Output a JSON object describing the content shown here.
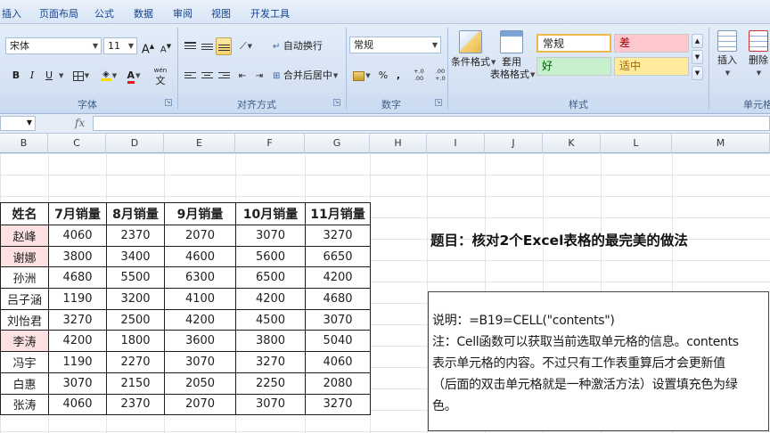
{
  "menu": {
    "items": [
      "插入",
      "页面布局",
      "公式",
      "数据",
      "审阅",
      "视图",
      "开发工具"
    ]
  },
  "ribbon": {
    "font_group": {
      "label": "字体",
      "font_name": "宋体",
      "font_size": "11",
      "grow_label": "A",
      "shrink_label": "A",
      "bold": "B",
      "italic": "I",
      "underline": "U",
      "font_color_label": "A",
      "phonetic_label": "wén",
      "phonetic_char": "文"
    },
    "align_group": {
      "label": "对齐方式",
      "wrap_label": "自动换行",
      "merge_label": "合并后居中"
    },
    "number_group": {
      "label": "数字",
      "format": "常规",
      "percent": "%",
      "comma": ",",
      "inc_decimal": "+.0 .00",
      "dec_decimal": ".00 +.0"
    },
    "styles_group": {
      "label": "样式",
      "conditional_label": "条件格式",
      "table_label_1": "套用",
      "table_label_2": "表格格式",
      "styles": {
        "normal": "常规",
        "bad": "差",
        "good": "好",
        "neutral": "适中"
      }
    },
    "cells_group": {
      "label": "单元格",
      "insert_label": "插入",
      "delete_label": "删除"
    }
  },
  "formula_bar": {
    "fx_label": "fx",
    "value": ""
  },
  "columns": [
    "B",
    "C",
    "D",
    "E",
    "F",
    "G",
    "H",
    "I",
    "J",
    "K",
    "L",
    "M"
  ],
  "table": {
    "headers": [
      "姓名",
      "7月销量",
      "8月销量",
      "9月销量",
      "10月销量",
      "11月销量"
    ],
    "rows": [
      {
        "name": "赵峰",
        "values": [
          "4060",
          "2370",
          "2070",
          "3070",
          "3270"
        ],
        "highlight": true
      },
      {
        "name": "谢娜",
        "values": [
          "3800",
          "3400",
          "4600",
          "5600",
          "6650"
        ],
        "highlight": true
      },
      {
        "name": "孙洲",
        "values": [
          "4680",
          "5500",
          "6300",
          "6500",
          "4200"
        ],
        "highlight": false
      },
      {
        "name": "吕子涵",
        "values": [
          "1190",
          "3200",
          "4100",
          "4200",
          "4680"
        ],
        "highlight": false
      },
      {
        "name": "刘怡君",
        "values": [
          "3270",
          "2500",
          "4200",
          "4500",
          "3070"
        ],
        "highlight": false
      },
      {
        "name": "李涛",
        "values": [
          "4200",
          "1800",
          "3600",
          "3800",
          "5040"
        ],
        "highlight": true
      },
      {
        "name": "冯宇",
        "values": [
          "1190",
          "2270",
          "3070",
          "3270",
          "4060"
        ],
        "highlight": false
      },
      {
        "name": "白惠",
        "values": [
          "3070",
          "2150",
          "2050",
          "2250",
          "2080"
        ],
        "highlight": false
      },
      {
        "name": "张涛",
        "values": [
          "4060",
          "2370",
          "2070",
          "3070",
          "3270"
        ],
        "highlight": false
      }
    ]
  },
  "headline": "题目：核对2个Excel表格的最完美的做法",
  "note": {
    "lines": [
      "说明：=B19=CELL(\"contents\")",
      "注：Cell函数可以获取当前选取单元格的信息。contents",
      "表示单元格的内容。不过只有工作表重算后才会更新值",
      "（后面的双击单元格就是一种激活方法）设置填充色为绿",
      "色。"
    ]
  },
  "colors": {
    "highlight_text": "#e03030",
    "highlight_fill": "#fde1e2",
    "good_fill": "#c6efce",
    "good_text": "#006100",
    "bad_fill": "#ffc7ce",
    "bad_text": "#9c0006",
    "neutral_fill": "#ffeb9c",
    "neutral_text": "#9c6500"
  }
}
